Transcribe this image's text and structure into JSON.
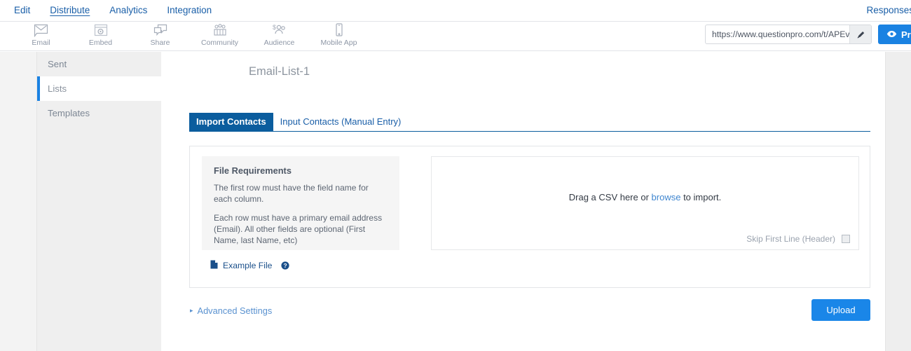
{
  "topnav": {
    "items": [
      {
        "label": "Edit",
        "active": false
      },
      {
        "label": "Distribute",
        "active": true
      },
      {
        "label": "Analytics",
        "active": false
      },
      {
        "label": "Integration",
        "active": false
      }
    ],
    "right_item": "Responses"
  },
  "toolbar": {
    "items": [
      {
        "label": "Email",
        "icon": "envelope-icon"
      },
      {
        "label": "Embed",
        "icon": "embed-code-icon"
      },
      {
        "label": "Share",
        "icon": "share-bubbles-icon"
      },
      {
        "label": "Community",
        "icon": "community-people-icon"
      },
      {
        "label": "Audience",
        "icon": "audience-money-icon"
      },
      {
        "label": "Mobile App",
        "icon": "mobile-phone-icon"
      }
    ]
  },
  "survey_url": {
    "value": "https://www.questionpro.com/t/APEvHZ",
    "edit_icon": "pencil-icon"
  },
  "preview_button": {
    "label": "Preview",
    "icon": "eye-icon"
  },
  "sidebar": {
    "items": [
      {
        "label": "Sent",
        "active": false
      },
      {
        "label": "Lists",
        "active": true
      },
      {
        "label": "Templates",
        "active": false
      }
    ]
  },
  "main": {
    "page_title": "Email-List-1",
    "tabs": [
      {
        "label": "Import Contacts",
        "active": true
      },
      {
        "label": "Input Contacts (Manual Entry)",
        "active": false
      }
    ],
    "file_requirements": {
      "heading": "File Requirements",
      "paragraph1": "The first row must have the field name for each column.",
      "paragraph2": "Each row must have a primary email address (Email). All other fields are optional (First Name, last Name, etc)"
    },
    "example_file": {
      "label": "Example File",
      "doc_icon": "document-icon",
      "help_icon": "help-circle-icon"
    },
    "dropzone": {
      "text_before": "Drag a CSV here or ",
      "link": "browse",
      "text_after": " to import.",
      "skip_first_line_label": "Skip First Line (Header)",
      "skip_first_line_checked": false
    },
    "advanced_settings": {
      "label": "Advanced Settings",
      "caret": "▸"
    },
    "upload_button": {
      "label": "Upload"
    }
  },
  "colors": {
    "accent_blue": "#1a82e2",
    "tab_active_blue": "#0b5d9e",
    "link_blue": "#1a5fa8",
    "sidebar_bg": "#efefef",
    "panel_gray": "#f5f5f5"
  }
}
